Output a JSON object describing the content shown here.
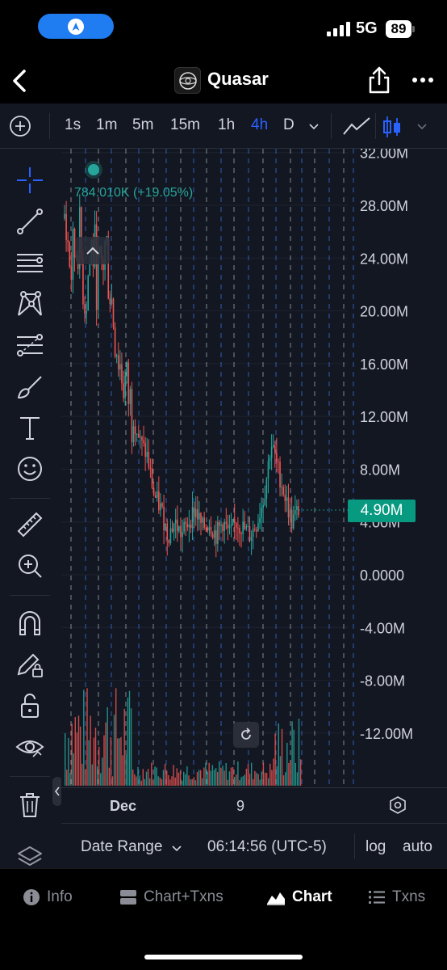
{
  "status_bar": {
    "network": "5G",
    "battery": "89"
  },
  "header": {
    "title": "Quasar"
  },
  "toolbar": {
    "timeframes": [
      "1s",
      "1m",
      "5m",
      "15m",
      "1h",
      "4h",
      "D"
    ],
    "active_timeframe": "4h"
  },
  "legend": {
    "value_text": "784.010K (+19.05%)"
  },
  "price_axis": {
    "labels": [
      "32.00M",
      "28.00M",
      "24.00M",
      "20.00M",
      "16.00M",
      "12.00M",
      "8.00M",
      "4.00M",
      "0.0000",
      "-4.00M",
      "-8.00M",
      "-12.00M"
    ],
    "current_price": "4.90M"
  },
  "time_axis": {
    "labels": [
      "Dec",
      "9"
    ]
  },
  "info_bar": {
    "date_range": "Date Range",
    "time": "06:14:56 (UTC-5)",
    "log": "log",
    "auto": "auto"
  },
  "tabs": [
    {
      "label": "Info",
      "icon": "info-icon"
    },
    {
      "label": "Chart+Txns",
      "icon": "split-view-icon"
    },
    {
      "label": "Chart",
      "icon": "area-chart-icon",
      "active": true
    },
    {
      "label": "Txns",
      "icon": "list-icon"
    }
  ],
  "rail_tools": [
    "crosshair-icon",
    "trend-line-icon",
    "horizontal-lines-icon",
    "pattern-icon",
    "fib-icon",
    "brush-icon",
    "text-icon",
    "emoji-icon",
    "ruler-icon",
    "zoom-in-icon",
    "magnet-icon",
    "lock-pencil-icon",
    "unlock-icon",
    "eye-icon",
    "trash-icon",
    "layers-icon"
  ],
  "colors": {
    "up": "#26a69a",
    "down": "#ef5350",
    "accent": "#2962ff",
    "background": "#131722",
    "price_label": "#089981"
  },
  "chart_data": {
    "type": "candlestick",
    "y_axis_range": [
      -14000000,
      33000000
    ],
    "last_price": 4900000,
    "legend_change_percent": 19.05,
    "x_labels": [
      "Dec",
      "9"
    ],
    "close_path": [
      27000000,
      23000000,
      26000000,
      21000000,
      25000000,
      22000000,
      25000000,
      20000000,
      16000000,
      14000000,
      12000000,
      10000000,
      9000000,
      6000000,
      5000000,
      3000000,
      4000000,
      3000000,
      4000000,
      5000000,
      3500000,
      4000000,
      3000000,
      4000000,
      3000000,
      4000000,
      3500000,
      3000000,
      4000000,
      6000000,
      10000000,
      8000000,
      6000000,
      4000000,
      4900000
    ]
  }
}
